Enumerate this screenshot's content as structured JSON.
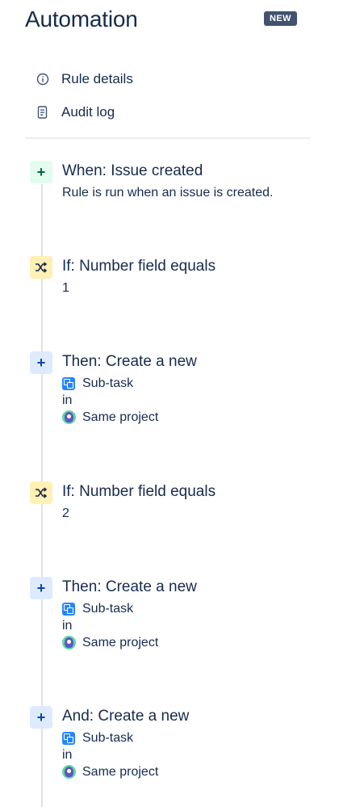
{
  "header": {
    "title": "Automation",
    "badge": "NEW"
  },
  "menu": [
    {
      "label": "Rule details",
      "icon": "info-icon"
    },
    {
      "label": "Audit log",
      "icon": "document-icon"
    }
  ],
  "steps": [
    {
      "type": "trigger",
      "icon": "plus-icon",
      "title": "When: Issue created",
      "description": "Rule is run when an issue is created."
    },
    {
      "type": "condition",
      "icon": "shuffle-icon",
      "title": "If: Number field equals",
      "value": "1"
    },
    {
      "type": "action",
      "icon": "plus-icon",
      "title": "Then: Create a new",
      "issue_type": "Sub-task",
      "connector": "in",
      "project": "Same project"
    },
    {
      "type": "condition",
      "icon": "shuffle-icon",
      "title": "If: Number field equals",
      "value": "2"
    },
    {
      "type": "action",
      "icon": "plus-icon",
      "title": "Then: Create a new",
      "issue_type": "Sub-task",
      "connector": "in",
      "project": "Same project"
    },
    {
      "type": "action",
      "icon": "plus-icon",
      "title": "And: Create a new",
      "issue_type": "Sub-task",
      "connector": "in",
      "project": "Same project"
    }
  ],
  "colors": {
    "text": "#172b4d",
    "badge_bg": "#42526e",
    "trigger_bg": "#e3fcef",
    "condition_bg": "#fff0b3",
    "action_bg": "#deebff",
    "subtask_blue": "#2684ff"
  }
}
